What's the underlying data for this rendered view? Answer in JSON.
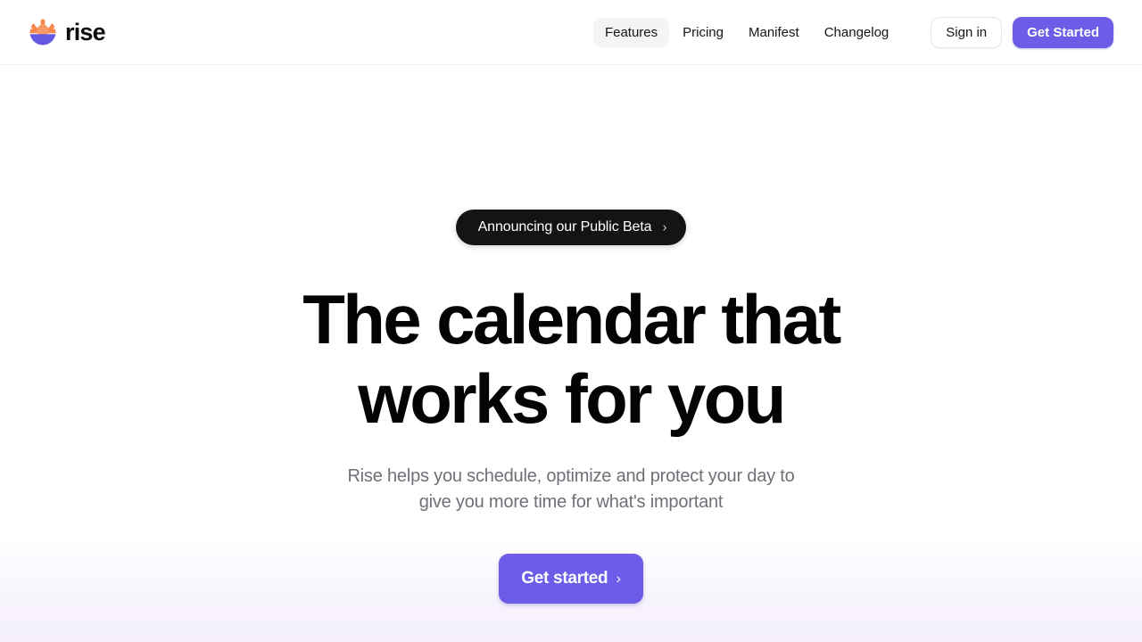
{
  "brand": {
    "name": "rise",
    "logo_icon": "sunrise-icon",
    "logo_colors": {
      "rays": "#f9854f",
      "sun_body": "#f79a63",
      "horizon": "#6457e0"
    }
  },
  "nav": {
    "items": [
      {
        "label": "Features",
        "active": true
      },
      {
        "label": "Pricing",
        "active": false
      },
      {
        "label": "Manifest",
        "active": false
      },
      {
        "label": "Changelog",
        "active": false
      }
    ],
    "sign_in_label": "Sign in",
    "get_started_label": "Get Started"
  },
  "hero": {
    "announcement": {
      "label": "Announcing our Public Beta",
      "chevron": "›",
      "background": "#141414"
    },
    "title_line_1": "The calendar that",
    "title_line_2": "works for you",
    "subtitle_line_1": "Rise helps you schedule, optimize and protect your day to",
    "subtitle_line_2": "give you more time for what's important",
    "cta_label": "Get started",
    "cta_chevron": "›"
  },
  "theme": {
    "accent": "#6c5ce7",
    "text": "#040404",
    "muted_text": "#6f6f77",
    "background": "#ffffff",
    "bottom_wash": "#f6f1fb"
  }
}
